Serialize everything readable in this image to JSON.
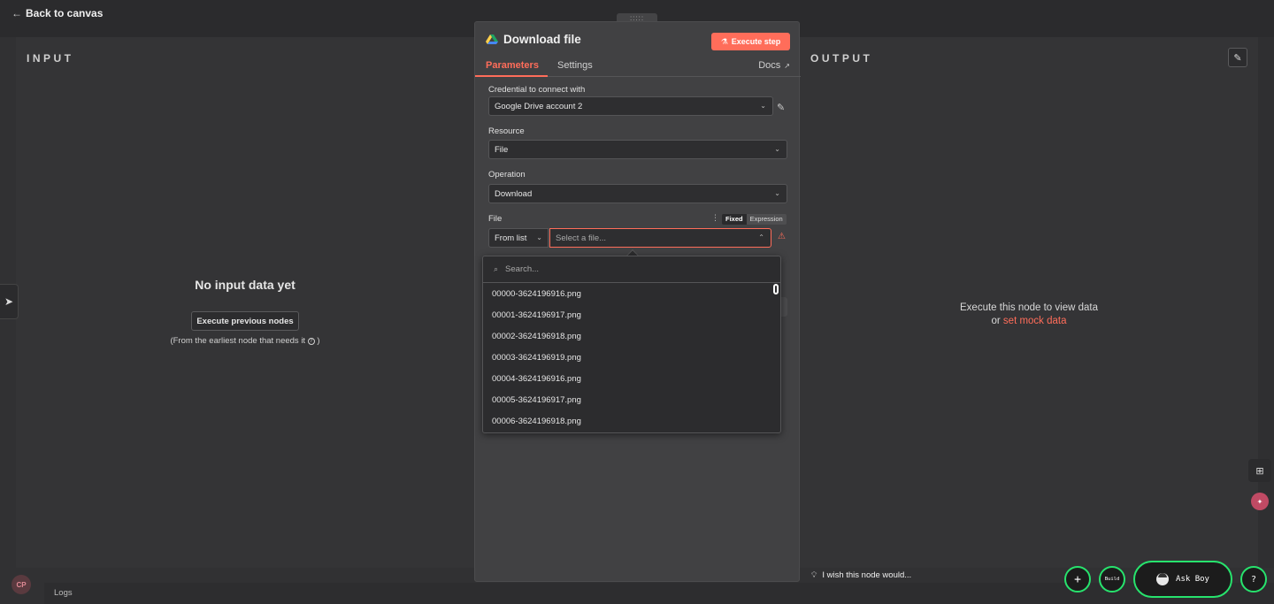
{
  "topbar": {
    "back_label": "Back to canvas"
  },
  "input_panel": {
    "title": "INPUT",
    "empty_title": "No input data yet",
    "execute_prev_label": "Execute previous nodes",
    "earliest_note": "(From the earliest node that needs it",
    "earliest_note_end": ")"
  },
  "output_panel": {
    "title": "OUTPUT",
    "message_line1": "Execute this node to view data",
    "message_or": "or",
    "mock_link": "set mock data"
  },
  "node": {
    "title": "Download file",
    "execute_step_label": "Execute step",
    "tabs": [
      "Parameters",
      "Settings"
    ],
    "active_tab": "Parameters",
    "docs_label": "Docs",
    "credential_label": "Credential to connect with",
    "credential_value": "Google Drive account 2",
    "resource_label": "Resource",
    "resource_value": "File",
    "operation_label": "Operation",
    "operation_value": "Download",
    "file_label": "File",
    "fixed_label": "Fixed",
    "expression_label": "Expression",
    "mode_value": "From list",
    "file_placeholder": "Select a file..."
  },
  "dropdown": {
    "search_placeholder": "Search...",
    "items": [
      "00000-3624196916.png",
      "00001-3624196917.png",
      "00002-3624196918.png",
      "00003-3624196919.png",
      "00004-3624196916.png",
      "00005-3624196917.png",
      "00006-3624196918.png"
    ]
  },
  "bottom": {
    "logs_label": "Logs",
    "wish_label": "I wish this node would...",
    "avatar_initials": "CP",
    "plus_label": "+",
    "build_label": "Build",
    "askboy_label": "Ask Boy",
    "help_label": "?"
  },
  "colors": {
    "accent": "#ff6d5a",
    "green": "#27e36d",
    "background": "#313133"
  }
}
